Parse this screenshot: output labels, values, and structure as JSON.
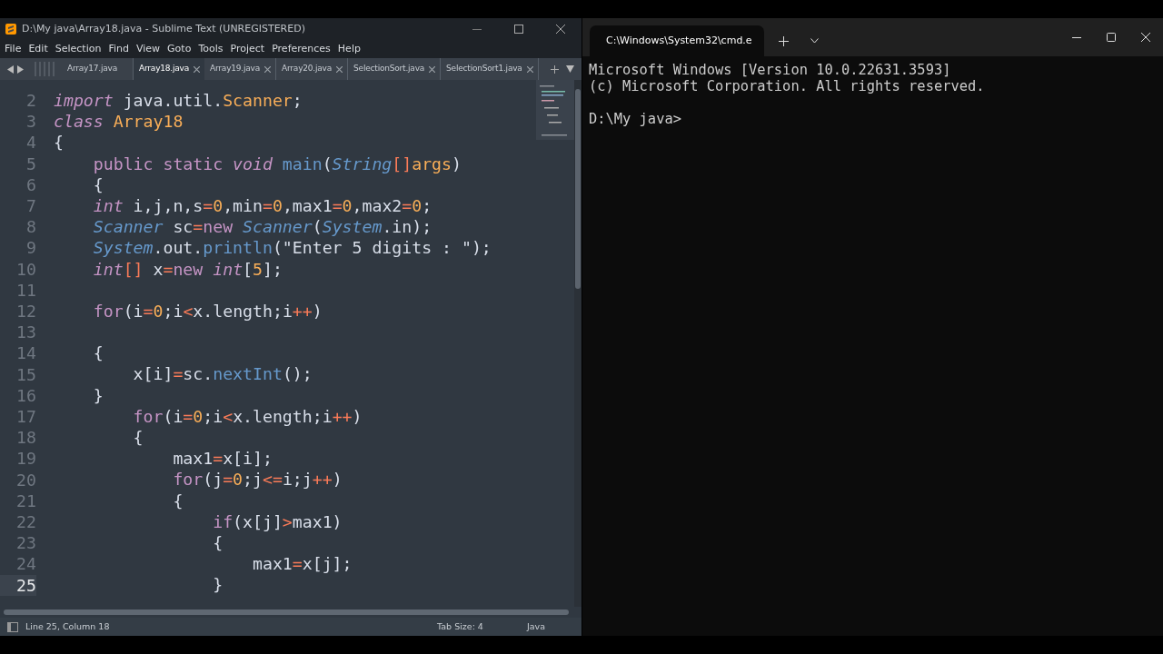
{
  "editor": {
    "window": {
      "title": "D:\\My java\\Array18.java - Sublime Text (UNREGISTERED)"
    },
    "menu": [
      "File",
      "Edit",
      "Selection",
      "Find",
      "View",
      "Goto",
      "Tools",
      "Project",
      "Preferences",
      "Help"
    ],
    "tabs": [
      {
        "label": "Array17.java",
        "selected": false,
        "close_shown": false
      },
      {
        "label": "Array18.java",
        "selected": true,
        "close_shown": true
      },
      {
        "label": "Array19.java",
        "selected": false,
        "close_shown": true
      },
      {
        "label": "Array20.java",
        "selected": false,
        "close_shown": true
      },
      {
        "label": "SelectionSort.java",
        "selected": false,
        "close_shown": true
      },
      {
        "label": "SelectionSort1.java",
        "selected": false,
        "close_shown": true
      }
    ],
    "lines": [
      {
        "number": "2",
        "current": false,
        "segments": [
          {
            "kind": "storage",
            "text": "import"
          },
          {
            "kind": "plain",
            "text": " java.util."
          },
          {
            "kind": "cls",
            "text": "Scanner"
          },
          {
            "kind": "plain",
            "text": ";"
          }
        ]
      },
      {
        "number": "3",
        "current": false,
        "segments": [
          {
            "kind": "storage",
            "text": "class"
          },
          {
            "kind": "cls",
            "text": " Array18"
          }
        ]
      },
      {
        "number": "4",
        "current": false,
        "segments": [
          {
            "kind": "plain",
            "text": "{"
          }
        ]
      },
      {
        "number": "5",
        "current": false,
        "segments": [
          {
            "kind": "keyword",
            "text": "    public"
          },
          {
            "kind": "keyword",
            "text": " static"
          },
          {
            "kind": "storage",
            "text": " void"
          },
          {
            "kind": "func",
            "text": " main"
          },
          {
            "kind": "plain",
            "text": "("
          },
          {
            "kind": "type",
            "text": "String"
          },
          {
            "kind": "op",
            "text": "[]"
          },
          {
            "kind": "cls",
            "text": "args"
          },
          {
            "kind": "plain",
            "text": ")"
          }
        ]
      },
      {
        "number": "6",
        "current": false,
        "segments": [
          {
            "kind": "plain",
            "text": "    {"
          }
        ]
      },
      {
        "number": "7",
        "current": false,
        "segments": [
          {
            "kind": "storage",
            "text": "    int"
          },
          {
            "kind": "plain",
            "text": " i,j,n,s"
          },
          {
            "kind": "op",
            "text": "="
          },
          {
            "kind": "num",
            "text": "0"
          },
          {
            "kind": "plain",
            "text": ",min"
          },
          {
            "kind": "op",
            "text": "="
          },
          {
            "kind": "num",
            "text": "0"
          },
          {
            "kind": "plain",
            "text": ",max1"
          },
          {
            "kind": "op",
            "text": "="
          },
          {
            "kind": "num",
            "text": "0"
          },
          {
            "kind": "plain",
            "text": ",max2"
          },
          {
            "kind": "op",
            "text": "="
          },
          {
            "kind": "num",
            "text": "0"
          },
          {
            "kind": "plain",
            "text": ";"
          }
        ]
      },
      {
        "number": "8",
        "current": false,
        "segments": [
          {
            "kind": "type",
            "text": "    Scanner"
          },
          {
            "kind": "plain",
            "text": " sc"
          },
          {
            "kind": "op",
            "text": "="
          },
          {
            "kind": "keyword",
            "text": "new"
          },
          {
            "kind": "type",
            "text": " Scanner"
          },
          {
            "kind": "plain",
            "text": "("
          },
          {
            "kind": "type",
            "text": "System"
          },
          {
            "kind": "plain",
            "text": ".in);"
          }
        ]
      },
      {
        "number": "9",
        "current": false,
        "segments": [
          {
            "kind": "type",
            "text": "    System"
          },
          {
            "kind": "plain",
            "text": ".out."
          },
          {
            "kind": "func",
            "text": "println"
          },
          {
            "kind": "plain",
            "text": "(\"Enter 5 digits : \");"
          }
        ]
      },
      {
        "number": "10",
        "current": false,
        "segments": [
          {
            "kind": "storage",
            "text": "    int"
          },
          {
            "kind": "op",
            "text": "[]"
          },
          {
            "kind": "plain",
            "text": " x"
          },
          {
            "kind": "op",
            "text": "="
          },
          {
            "kind": "keyword",
            "text": "new"
          },
          {
            "kind": "storage",
            "text": " int"
          },
          {
            "kind": "plain",
            "text": "["
          },
          {
            "kind": "num",
            "text": "5"
          },
          {
            "kind": "plain",
            "text": "];"
          }
        ]
      },
      {
        "number": "11",
        "current": false
      },
      {
        "number": "12",
        "current": false,
        "segments": [
          {
            "kind": "keyword",
            "text": "    for"
          },
          {
            "kind": "plain",
            "text": "(i"
          },
          {
            "kind": "op",
            "text": "="
          },
          {
            "kind": "num",
            "text": "0"
          },
          {
            "kind": "plain",
            "text": ";i"
          },
          {
            "kind": "op",
            "text": "<"
          },
          {
            "kind": "plain",
            "text": "x.length;i"
          },
          {
            "kind": "op",
            "text": "++"
          },
          {
            "kind": "plain",
            "text": ")"
          }
        ]
      },
      {
        "number": "13",
        "current": false
      },
      {
        "number": "14",
        "current": false,
        "segments": [
          {
            "kind": "plain",
            "text": "    {"
          }
        ]
      },
      {
        "number": "15",
        "current": false,
        "segments": [
          {
            "kind": "plain",
            "text": "        x[i]"
          },
          {
            "kind": "op",
            "text": "="
          },
          {
            "kind": "plain",
            "text": "sc."
          },
          {
            "kind": "func",
            "text": "nextInt"
          },
          {
            "kind": "plain",
            "text": "();"
          }
        ]
      },
      {
        "number": "16",
        "current": false,
        "segments": [
          {
            "kind": "plain",
            "text": "    }"
          }
        ]
      },
      {
        "number": "17",
        "current": false,
        "segments": [
          {
            "kind": "keyword",
            "text": "        for"
          },
          {
            "kind": "plain",
            "text": "(i"
          },
          {
            "kind": "op",
            "text": "="
          },
          {
            "kind": "num",
            "text": "0"
          },
          {
            "kind": "plain",
            "text": ";i"
          },
          {
            "kind": "op",
            "text": "<"
          },
          {
            "kind": "plain",
            "text": "x.length;i"
          },
          {
            "kind": "op",
            "text": "++"
          },
          {
            "kind": "plain",
            "text": ")"
          }
        ]
      },
      {
        "number": "18",
        "current": false,
        "segments": [
          {
            "kind": "plain",
            "text": "        {"
          }
        ]
      },
      {
        "number": "19",
        "current": false,
        "segments": [
          {
            "kind": "plain",
            "text": "            max1"
          },
          {
            "kind": "op",
            "text": "="
          },
          {
            "kind": "plain",
            "text": "x[i];"
          }
        ]
      },
      {
        "number": "20",
        "current": false,
        "segments": [
          {
            "kind": "keyword",
            "text": "            for"
          },
          {
            "kind": "plain",
            "text": "(j"
          },
          {
            "kind": "op",
            "text": "="
          },
          {
            "kind": "num",
            "text": "0"
          },
          {
            "kind": "plain",
            "text": ";j"
          },
          {
            "kind": "op",
            "text": "<="
          },
          {
            "kind": "plain",
            "text": "i;j"
          },
          {
            "kind": "op",
            "text": "++"
          },
          {
            "kind": "plain",
            "text": ")"
          }
        ]
      },
      {
        "number": "21",
        "current": false,
        "segments": [
          {
            "kind": "plain",
            "text": "            {"
          }
        ]
      },
      {
        "number": "22",
        "current": false,
        "segments": [
          {
            "kind": "keyword",
            "text": "                if"
          },
          {
            "kind": "plain",
            "text": "(x[j]"
          },
          {
            "kind": "op",
            "text": ">"
          },
          {
            "kind": "plain",
            "text": "max1)"
          }
        ]
      },
      {
        "number": "23",
        "current": false,
        "segments": [
          {
            "kind": "plain",
            "text": "                {"
          }
        ]
      },
      {
        "number": "24",
        "current": false,
        "segments": [
          {
            "kind": "plain",
            "text": "                    max1"
          },
          {
            "kind": "op",
            "text": "="
          },
          {
            "kind": "plain",
            "text": "x[j];"
          }
        ]
      },
      {
        "number": "25",
        "current": true,
        "segments": [
          {
            "kind": "plain",
            "text": "                }"
          }
        ]
      }
    ],
    "status_bar": {
      "position": "Line 25, Column 18",
      "tab_size": "Tab Size: 4",
      "syntax": "Java"
    }
  },
  "terminal": {
    "tab": {
      "title": "C:\\Windows\\System32\\cmd.e"
    },
    "banner": [
      "Microsoft Windows [Version 10.0.22631.3593]",
      "(c) Microsoft Corporation. All rights reserved."
    ],
    "prompt": "D:\\My java>"
  }
}
